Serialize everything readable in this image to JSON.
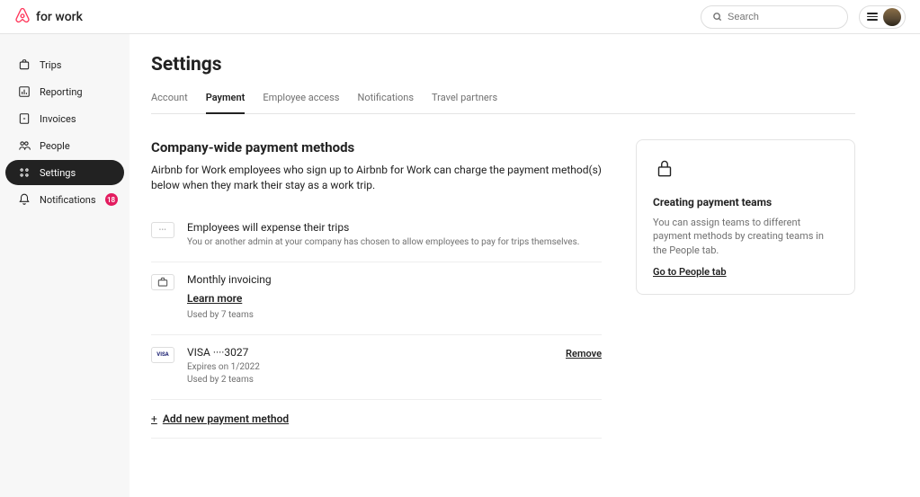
{
  "brand": "for work",
  "search": {
    "placeholder": "Search"
  },
  "sidebar": {
    "items": [
      {
        "label": "Trips"
      },
      {
        "label": "Reporting"
      },
      {
        "label": "Invoices"
      },
      {
        "label": "People"
      },
      {
        "label": "Settings"
      },
      {
        "label": "Notifications",
        "badge": "18"
      }
    ]
  },
  "page": {
    "title": "Settings",
    "tabs": [
      "Account",
      "Payment",
      "Employee access",
      "Notifications",
      "Travel partners"
    ]
  },
  "section": {
    "title": "Company-wide payment methods",
    "desc": "Airbnb for Work employees who sign up to Airbnb for Work can charge the payment method(s) below when they mark their stay as a work trip."
  },
  "paymentMethods": {
    "expense": {
      "title": "Employees will expense their trips",
      "sub": "You or another admin at your company has chosen to allow employees to pay for trips themselves."
    },
    "monthly": {
      "title": "Monthly invoicing",
      "learnMore": "Learn more",
      "usedBy": "Used by 7 teams"
    },
    "card": {
      "title": "VISA ····3027",
      "expires": "Expires on 1/2022",
      "usedBy": "Used by 2 teams",
      "removeLabel": "Remove",
      "brand": "VISA"
    }
  },
  "addLabel": "Add new payment method",
  "infoCard": {
    "title": "Creating payment teams",
    "desc": "You can assign teams to different payment methods by creating teams in the People tab.",
    "link": "Go to People tab"
  }
}
